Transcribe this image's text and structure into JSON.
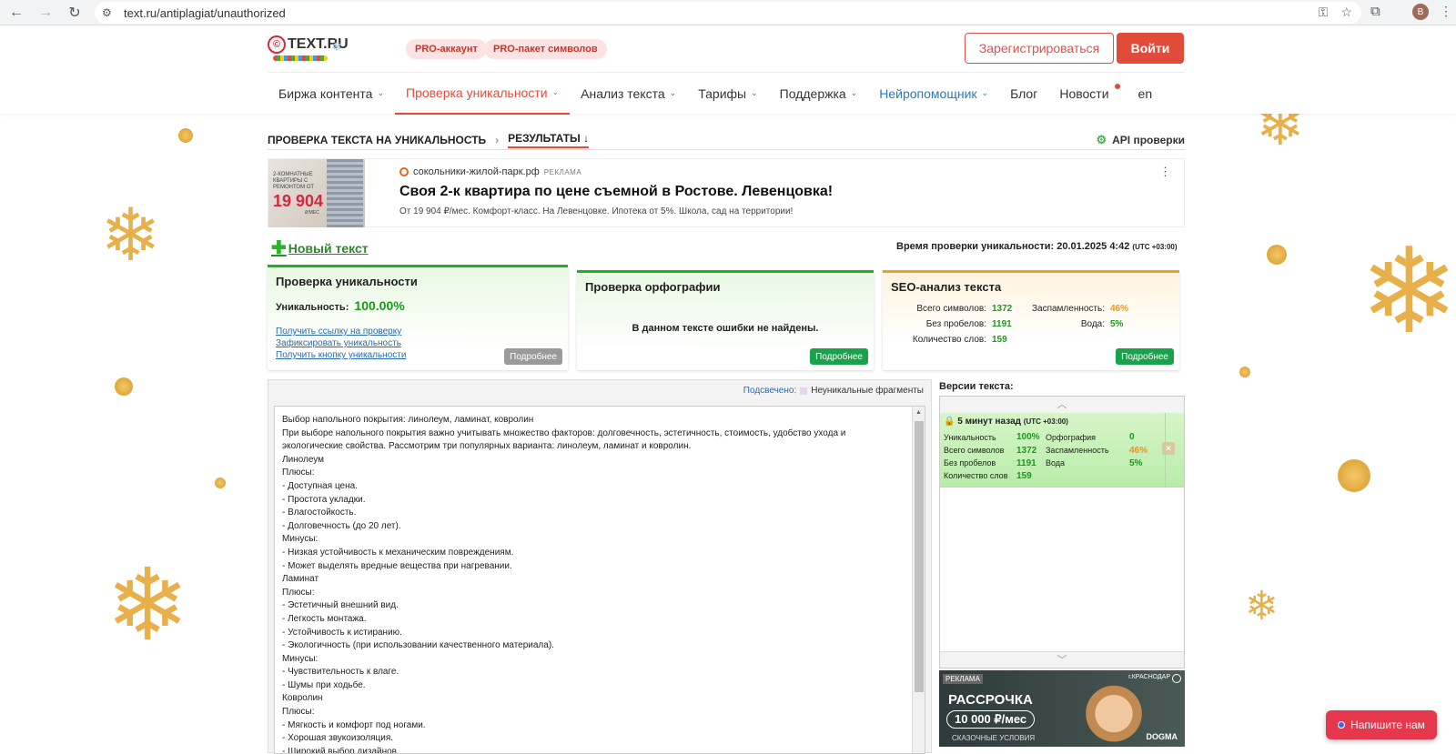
{
  "browser": {
    "url": "text.ru/antiplagiat/unauthorized",
    "avatar_letter": "B"
  },
  "header": {
    "logo": "TEXT.RU",
    "pro_account": "PRO-аккаунт",
    "pro_package": "PRO-пакет символов",
    "register": "Зарегистрироваться",
    "login": "Войти"
  },
  "menu": {
    "items": [
      {
        "label": "Биржа контента",
        "chevron": true
      },
      {
        "label": "Проверка уникальности",
        "chevron": true,
        "active": true
      },
      {
        "label": "Анализ текста",
        "chevron": true
      },
      {
        "label": "Тарифы",
        "chevron": true
      },
      {
        "label": "Поддержка",
        "chevron": true
      },
      {
        "label": "Нейропомощник",
        "chevron": true
      },
      {
        "label": "Блог"
      },
      {
        "label": "Новости"
      },
      {
        "label": "en"
      }
    ]
  },
  "breadcrumb": {
    "root": "ПРОВЕРКА ТЕКСТА НА УНИКАЛЬНОСТЬ",
    "current": "РЕЗУЛЬТАТЫ ↓",
    "api": "API проверки"
  },
  "ad_top": {
    "image_line1": "2-КОМНАТНЫЕ КВАРТИРЫ С РЕМОНТОМ ОТ",
    "image_price": "19 904",
    "image_unit": "₽/МЕС",
    "domain": "сокольники-жилой-парк.рф",
    "tag": "РЕКЛАМА",
    "title": "Своя 2-к квартира по цене съемной в Ростове. Левенцовка!",
    "desc": "От 19 904 ₽/мес. Комфорт-класс. На Левенцовке. Ипотека от 5%. Школа, сад на территории!"
  },
  "new_text": "Новый текст",
  "check_time": {
    "label": "Время проверки уникальности: 20.01.2025 4:42",
    "tz": "(UTC +03:00)"
  },
  "cards": {
    "uniqueness": {
      "title": "Проверка уникальности",
      "label": "Уникальность:",
      "value": "100.00%",
      "links": [
        "Получить ссылку на проверку",
        "Зафиксировать уникальность",
        "Получить кнопку уникальности"
      ],
      "more": "Подробнее"
    },
    "spelling": {
      "title": "Проверка орфографии",
      "message": "В данном тексте ошибки не найдены.",
      "more": "Подробнее"
    },
    "seo": {
      "title": "SEO-анализ текста",
      "total_chars_label": "Всего символов:",
      "total_chars": "1372",
      "no_spaces_label": "Без пробелов:",
      "no_spaces": "1191",
      "words_label": "Количество слов:",
      "words": "159",
      "spam_label": "Заспамленность:",
      "spam": "46%",
      "water_label": "Вода:",
      "water": "5%",
      "more": "Подробнее"
    }
  },
  "highlight": {
    "label": "Подсвечено:",
    "legend": "Неуникальные фрагменты"
  },
  "text_lines": [
    "Выбор напольного покрытия: линолеум, ламинат, ковролин",
    "При выборе напольного покрытия важно учитывать множество факторов: долговечность, эстетичность, стоимость, удобство ухода и",
    "экологические свойства. Рассмотрим три популярных варианта: линолеум, ламинат и ковролин.",
    "Линолеум",
    "Плюсы:",
    "- Доступная цена.",
    "- Простота укладки.",
    "- Влагостойкость.",
    "- Долговечность (до 20 лет).",
    "Минусы:",
    "- Низкая устойчивость к механическим повреждениям.",
    "- Может выделять вредные вещества при нагревании.",
    "Ламинат",
    "Плюсы:",
    "- Эстетичный внешний вид.",
    "- Легкость монтажа.",
    "- Устойчивость к истиранию.",
    "- Экологичность (при использовании качественного материала).",
    "Минусы:",
    "- Чувствительность к влаге.",
    "- Шумы при ходьбе.",
    "Ковролин",
    "Плюсы:",
    "- Мягкость и комфорт под ногами.",
    "- Хорошая звукоизоляция.",
    "- Широкий выбор дизайнов."
  ],
  "versions": {
    "title": "Версии текста:",
    "item": {
      "when": "5 минут назад",
      "tz": "(UTC +03:00)",
      "uniq_label": "Уникальность",
      "uniq": "100%",
      "chars_label": "Всего символов",
      "chars": "1372",
      "nospace_label": "Без пробелов",
      "nospace": "1191",
      "words_label": "Количество слов",
      "words": "159",
      "spell_label": "Орфография",
      "spell": "0",
      "spam_label": "Заспамленность",
      "spam": "46%",
      "water_label": "Вода",
      "water": "5%"
    }
  },
  "ad_bottom": {
    "head": "РЕКЛАМА",
    "city": "г.КРАСНОДАР",
    "title": "РАССРОЧКА",
    "price": "10 000 ₽/мес",
    "sub": "СКАЗОЧНЫЕ УСЛОВИЯ",
    "brand": "DOGMA"
  },
  "chat": "Напишите нам",
  "colors": {
    "accent_red": "#e04b3a",
    "green": "#1a9a1a",
    "orange": "#e8961a",
    "link_blue": "#2a6ab0"
  }
}
